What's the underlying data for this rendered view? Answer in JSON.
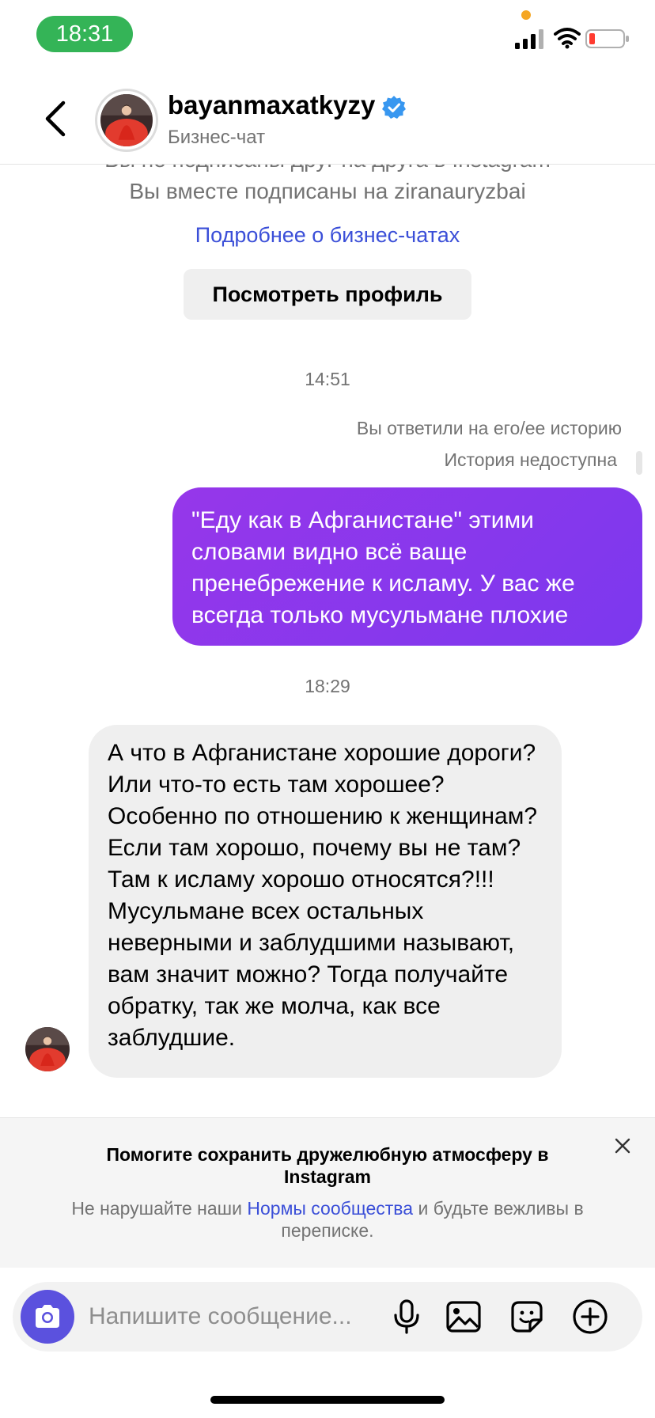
{
  "status_bar": {
    "time": "18:31",
    "icons": [
      "cellular-signal-icon",
      "wifi-icon",
      "battery-low-icon"
    ],
    "colors": {
      "time_pill": "#34b457",
      "privacy_dot": "#f5a623",
      "battery_low": "#ff3b30"
    }
  },
  "header": {
    "username": "bayanmaxatkyzy",
    "subtitle": "Бизнес-чат",
    "icons": [
      "back-chevron-icon",
      "verified-badge-icon"
    ],
    "colors": {
      "verified": "#3897f0"
    }
  },
  "chat": {
    "info_cut": "Вы не подписаны друг на друга в Instagram",
    "mutual_followers": "Вы вместе подписаны на ziranauryzbai",
    "learn_more": "Подробнее о бизнес-чатах",
    "view_profile": "Посмотреть профиль",
    "timestamp_1": "14:51",
    "story_reply": "Вы ответили на его/ее историю",
    "story_unavailable": "История недоступна",
    "outgoing_message": "\"Еду как в Афганистане\" этими словами видно всё ваще пренебрежение к исламу. У вас же всегда только мусульмане плохие",
    "timestamp_2": "18:29",
    "incoming_message": "А что в Афганистане хорошие дороги? Или что-то есть там хорошее? Особенно по отношению к женщинам? Если там хорошо, почему вы не там? Там к исламу хорошо относятся?!!!  Мусульмане всех остальных неверными и заблудшими называют, вам значит можно? Тогда получайте обратку, так же молча, как все заблудшие.",
    "colors": {
      "outgoing_bubble": "#8a37ec",
      "incoming_bubble": "#efefef",
      "link": "#3b4fd8"
    }
  },
  "notice": {
    "title": "Помогите сохранить дружелюбную атмосферу в Instagram",
    "body_before": "Не нарушайте наши ",
    "body_link": "Нормы сообщества",
    "body_after": " и будьте вежливы в переписке.",
    "icons": [
      "close-icon"
    ]
  },
  "composer": {
    "placeholder": "Напишите сообщение...",
    "icons": [
      "camera-icon",
      "microphone-icon",
      "image-icon",
      "sticker-icon",
      "plus-icon"
    ],
    "colors": {
      "camera_button": "#5b51de"
    }
  }
}
